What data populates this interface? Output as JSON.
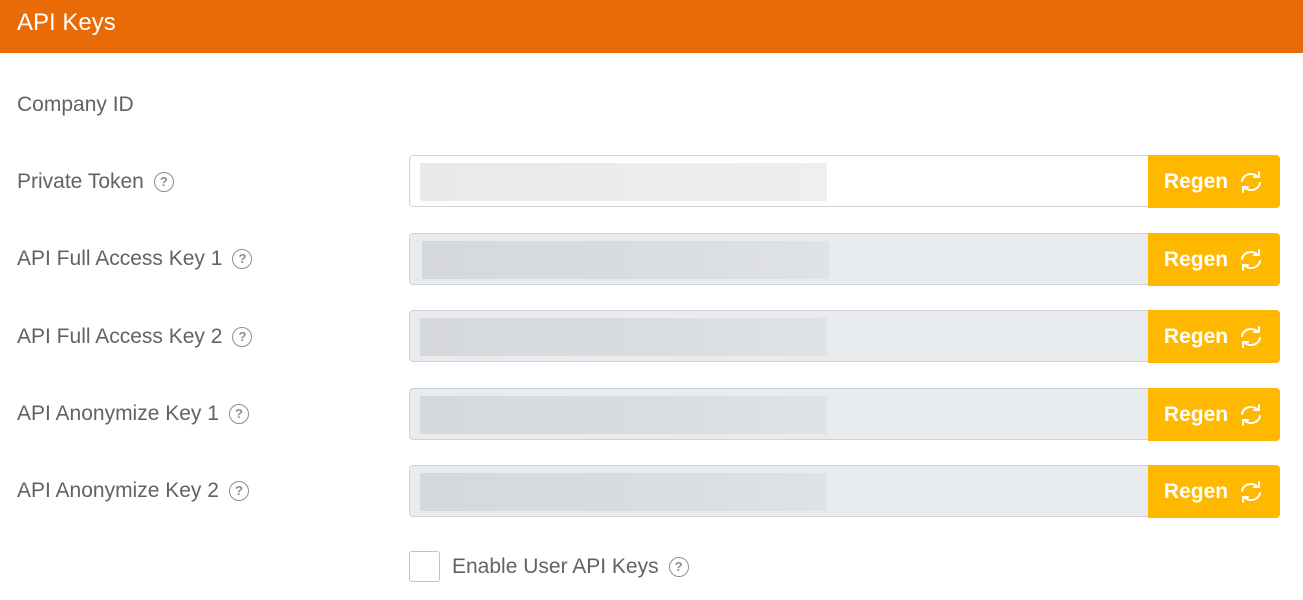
{
  "header": {
    "title": "API Keys"
  },
  "company": {
    "label": "Company ID"
  },
  "rows": [
    {
      "label": "Private Token",
      "button": "Regen"
    },
    {
      "label": "API Full Access Key 1",
      "button": "Regen"
    },
    {
      "label": "API Full Access Key 2",
      "button": "Regen"
    },
    {
      "label": "API Anonymize Key 1",
      "button": "Regen"
    },
    {
      "label": "API Anonymize Key 2",
      "button": "Regen"
    }
  ],
  "user_keys": {
    "label": "Enable User API Keys",
    "checked": false
  },
  "help_glyph": "?",
  "colors": {
    "header": "#e96b07",
    "button": "#ffb800"
  },
  "icons": {
    "help": "question-circle-icon",
    "regen": "refresh-icon"
  }
}
